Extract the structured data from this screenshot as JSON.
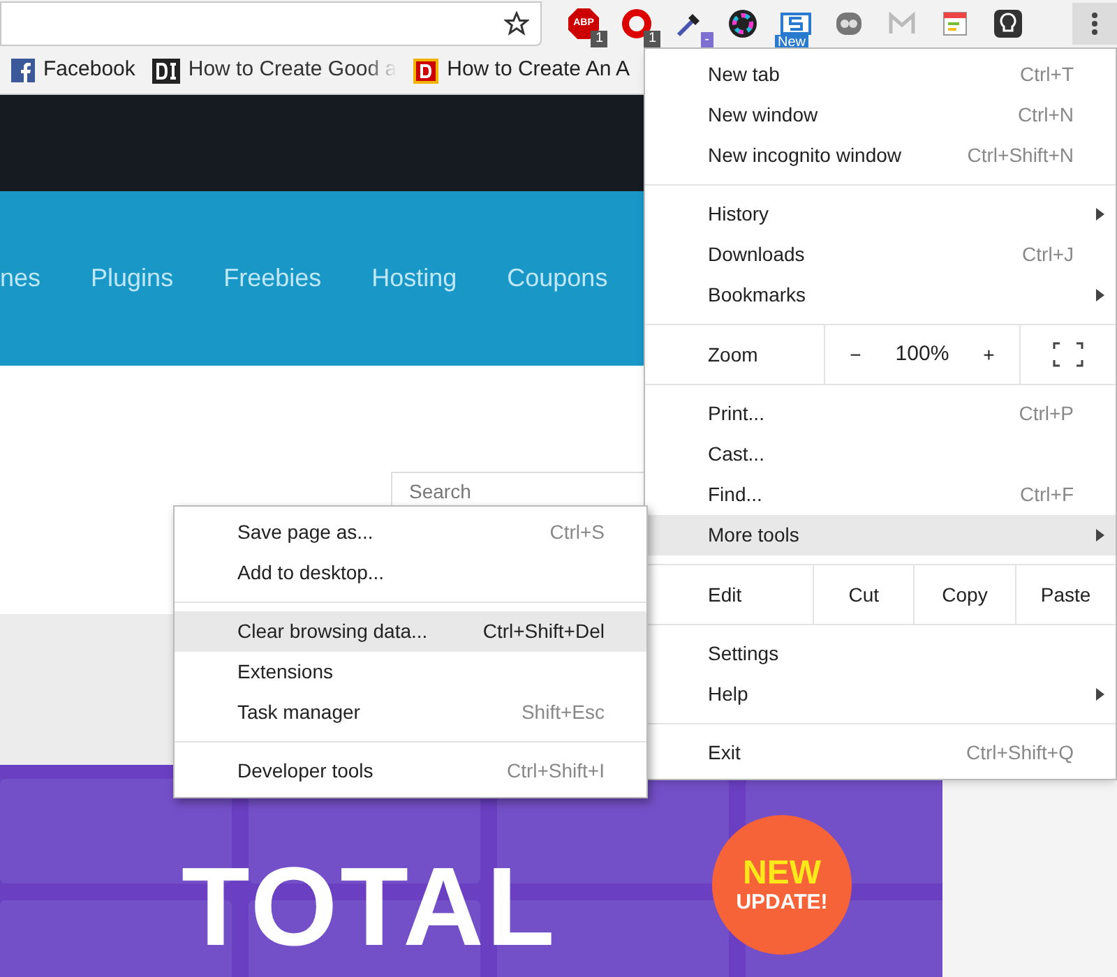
{
  "toolbar": {
    "extensions": [
      {
        "kind": "abp",
        "logo_text": "ABP",
        "badge": "1"
      },
      {
        "kind": "opera",
        "badge": "1"
      },
      {
        "kind": "dropper",
        "badge": "-"
      },
      {
        "kind": "color"
      },
      {
        "kind": "sbox",
        "badge": "New"
      },
      {
        "kind": "ghost"
      },
      {
        "kind": "mail"
      },
      {
        "kind": "note"
      },
      {
        "kind": "bulb"
      }
    ],
    "menu_button_selected": true
  },
  "bookmarks": [
    {
      "kind": "facebook",
      "label": "Facebook",
      "faded": false
    },
    {
      "kind": "di",
      "label": "How to Create Good a",
      "faded": true
    },
    {
      "kind": "d",
      "label": "How to Create An A",
      "faded": false
    }
  ],
  "site_nav": [
    "nes",
    "Plugins",
    "Freebies",
    "Hosting",
    "Coupons"
  ],
  "search": {
    "placeholder": "Search"
  },
  "banner": {
    "title": "TOTAL",
    "badge_line_1": "NEW",
    "badge_line_2": "UPDATE!"
  },
  "menu": {
    "items": [
      {
        "kind": "item",
        "label": "New tab",
        "shortcut": "Ctrl+T",
        "submenu": false,
        "selected": false
      },
      {
        "kind": "item",
        "label": "New window",
        "shortcut": "Ctrl+N",
        "submenu": false,
        "selected": false
      },
      {
        "kind": "item",
        "label": "New incognito window",
        "shortcut": "Ctrl+Shift+N",
        "submenu": false,
        "selected": false
      },
      {
        "kind": "separator"
      },
      {
        "kind": "item",
        "label": "History",
        "submenu": true,
        "selected": false
      },
      {
        "kind": "item",
        "label": "Downloads",
        "shortcut": "Ctrl+J",
        "submenu": false,
        "selected": false
      },
      {
        "kind": "item",
        "label": "Bookmarks",
        "submenu": true,
        "selected": false
      },
      {
        "kind": "separator"
      },
      {
        "kind": "zoom",
        "label": "Zoom",
        "minus": "−",
        "value": "100%",
        "plus": "+"
      },
      {
        "kind": "separator"
      },
      {
        "kind": "item",
        "label": "Print...",
        "shortcut": "Ctrl+P",
        "submenu": false,
        "selected": false
      },
      {
        "kind": "item",
        "label": "Cast...",
        "submenu": false,
        "selected": false
      },
      {
        "kind": "item",
        "label": "Find...",
        "shortcut": "Ctrl+F",
        "submenu": false,
        "selected": false
      },
      {
        "kind": "item",
        "label": "More tools",
        "submenu": true,
        "selected": true
      },
      {
        "kind": "separator"
      },
      {
        "kind": "edit",
        "label": "Edit",
        "buttons": [
          "Cut",
          "Copy",
          "Paste"
        ]
      },
      {
        "kind": "separator"
      },
      {
        "kind": "item",
        "label": "Settings",
        "submenu": false,
        "selected": false
      },
      {
        "kind": "item",
        "label": "Help",
        "submenu": true,
        "selected": false
      },
      {
        "kind": "separator"
      },
      {
        "kind": "item",
        "label": "Exit",
        "shortcut": "Ctrl+Shift+Q",
        "submenu": false,
        "selected": false
      }
    ]
  },
  "submenu": {
    "items": [
      {
        "kind": "item",
        "label": "Save page as...",
        "shortcut": "Ctrl+S",
        "selected": false
      },
      {
        "kind": "item",
        "label": "Add to desktop...",
        "selected": false
      },
      {
        "kind": "separator"
      },
      {
        "kind": "item",
        "label": "Clear browsing data...",
        "shortcut": "Ctrl+Shift+Del",
        "selected": true
      },
      {
        "kind": "item",
        "label": "Extensions",
        "selected": false
      },
      {
        "kind": "item",
        "label": "Task manager",
        "shortcut": "Shift+Esc",
        "selected": false
      },
      {
        "kind": "separator"
      },
      {
        "kind": "item",
        "label": "Developer tools",
        "shortcut": "Ctrl+Shift+I",
        "selected": false
      }
    ]
  }
}
